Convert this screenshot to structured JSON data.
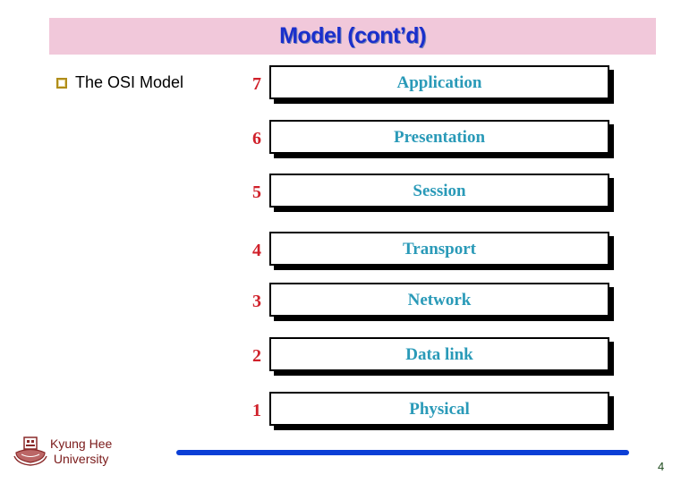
{
  "slide": {
    "title": "Model (cont’d)",
    "bullet": "The OSI Model",
    "layers": [
      {
        "number": "7",
        "name": "Application"
      },
      {
        "number": "6",
        "name": "Presentation"
      },
      {
        "number": "5",
        "name": "Session"
      },
      {
        "number": "4",
        "name": "Transport"
      },
      {
        "number": "3",
        "name": "Network"
      },
      {
        "number": "2",
        "name": "Data link"
      },
      {
        "number": "1",
        "name": "Physical"
      }
    ],
    "footer": {
      "university_line1": "Kyung Hee",
      "university_line2": "University",
      "page_number": "4"
    }
  },
  "colors": {
    "title_bar": "#f1c8da",
    "title_text": "#1a2fcc",
    "layer_text": "#2a9ab8",
    "layer_number": "#d0202a",
    "footer_line": "#0b3fd6",
    "university_text": "#7a1a1a"
  }
}
